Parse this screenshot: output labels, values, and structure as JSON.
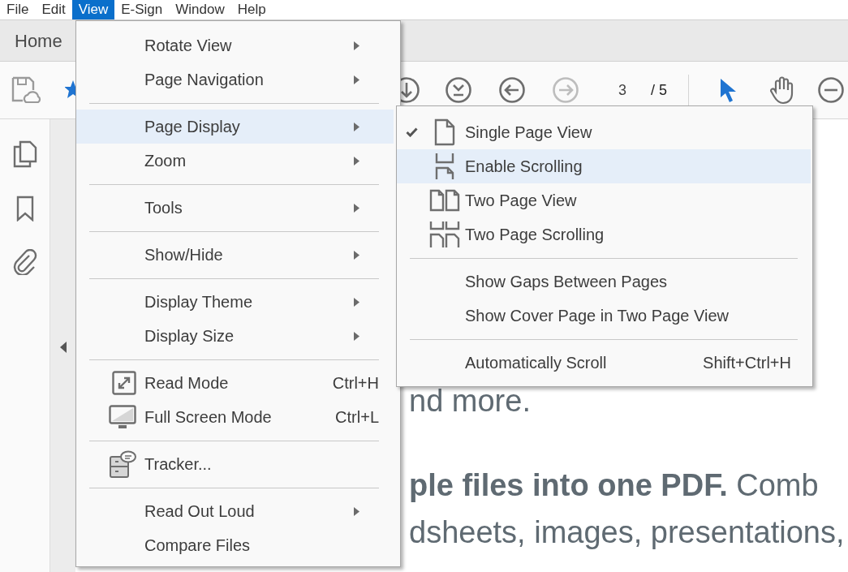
{
  "menubar": [
    {
      "label": "File",
      "selected": false
    },
    {
      "label": "Edit",
      "selected": false
    },
    {
      "label": "View",
      "selected": true
    },
    {
      "label": "E-Sign",
      "selected": false
    },
    {
      "label": "Window",
      "selected": false
    },
    {
      "label": "Help",
      "selected": false
    }
  ],
  "tabs": [
    {
      "label": "Home",
      "selected": false
    }
  ],
  "toolbar": {
    "page_number": "3",
    "page_total": "/ 5",
    "next_disabled": true
  },
  "document": {
    "lines": [
      "nd more.",
      "**ple files into one PDF.** Comb",
      "dsheets, images, presentations,"
    ]
  },
  "view_menu": {
    "items": [
      {
        "kind": "item",
        "label": "Rotate View",
        "submenu": true,
        "selected": false
      },
      {
        "kind": "item",
        "label": "Page Navigation",
        "submenu": true,
        "selected": false
      },
      {
        "kind": "separator"
      },
      {
        "kind": "item",
        "label": "Page Display",
        "submenu": true,
        "selected": true
      },
      {
        "kind": "item",
        "label": "Zoom",
        "submenu": true,
        "selected": false
      },
      {
        "kind": "separator"
      },
      {
        "kind": "item",
        "label": "Tools",
        "submenu": true,
        "selected": false
      },
      {
        "kind": "separator"
      },
      {
        "kind": "item",
        "label": "Show/Hide",
        "submenu": true,
        "selected": false
      },
      {
        "kind": "separator"
      },
      {
        "kind": "item",
        "label": "Display Theme",
        "submenu": true,
        "selected": false
      },
      {
        "kind": "item",
        "label": "Display Size",
        "submenu": true,
        "selected": false
      },
      {
        "kind": "separator"
      },
      {
        "kind": "icon",
        "label": "Read Mode",
        "shortcut": "Ctrl+H",
        "submenu": false,
        "selected": false
      },
      {
        "kind": "icon",
        "label": "Full Screen Mode",
        "shortcut": "Ctrl+L",
        "submenu": false,
        "selected": false
      },
      {
        "kind": "separator"
      },
      {
        "kind": "icon",
        "label": "Tracker...",
        "submenu": false,
        "selected": false
      },
      {
        "kind": "separator"
      },
      {
        "kind": "item",
        "label": "Read Out Loud",
        "submenu": true,
        "selected": false
      },
      {
        "kind": "item",
        "label": "Compare Files",
        "submenu": false,
        "selected": false
      }
    ]
  },
  "page_display_menu": {
    "items": [
      {
        "kind": "icon",
        "label": "Single Page View",
        "checked": true,
        "selected": false
      },
      {
        "kind": "icon",
        "label": "Enable Scrolling",
        "checked": false,
        "selected": true
      },
      {
        "kind": "icon",
        "label": "Two Page View",
        "checked": false,
        "selected": false
      },
      {
        "kind": "icon",
        "label": "Two Page Scrolling",
        "checked": false,
        "selected": false
      },
      {
        "kind": "separator"
      },
      {
        "kind": "item",
        "label": "Show Gaps Between Pages",
        "checked": false,
        "selected": false
      },
      {
        "kind": "item",
        "label": "Show Cover Page in Two Page View",
        "checked": false,
        "selected": false
      },
      {
        "kind": "separator"
      },
      {
        "kind": "item",
        "label": "Automatically Scroll",
        "shortcut": "Shift+Ctrl+H",
        "checked": false,
        "selected": false
      }
    ]
  }
}
